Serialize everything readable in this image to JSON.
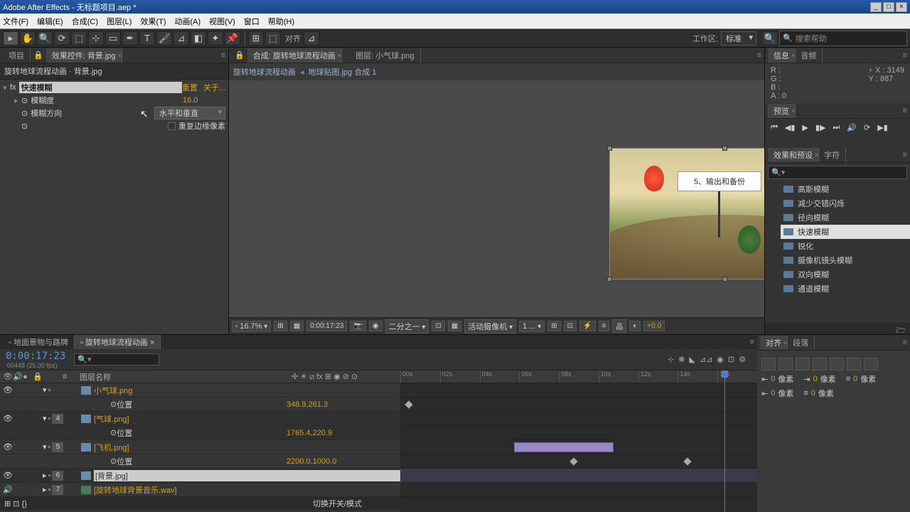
{
  "title": "Adobe After Effects - 无标题项目.aep *",
  "menu": [
    "文件(F)",
    "编辑(E)",
    "合成(C)",
    "图层(L)",
    "效果(T)",
    "动画(A)",
    "视图(V)",
    "窗口",
    "帮助(H)"
  ],
  "toolbar": {
    "snap": "对齐",
    "workspace_label": "工作区:",
    "workspace": "标准",
    "search_ph": "搜索帮助"
  },
  "left": {
    "tab_project": "项目",
    "tab_fx": "效果控件: 背景.jpg",
    "breadcrumb": "旋转地球流程动画 · 背景.jpg",
    "fx_name": "快速模糊",
    "reset": "重置",
    "about": "关于...",
    "p_blur": "模糊度",
    "v_blur": "16.0",
    "p_dir": "模糊方向",
    "v_dir": "水平和垂直",
    "p_edge": "重复边缘像素"
  },
  "comp": {
    "tab_comp": "合成: 旋转地球流程动画",
    "tab_layer": "图层: 小气球.png",
    "crumb1": "旋转地球流程动画",
    "crumb2": "地球贴图.jpg 合成 1",
    "billboard": "5、输出和备份",
    "zoom": "16.7%",
    "time": "0:00:17:23",
    "res": "二分之一",
    "cam": "活动摄像机",
    "views": "1 ...",
    "exp": "+0.0"
  },
  "info": {
    "tab1": "信息",
    "tab2": "音频",
    "r": "R :",
    "g": "G :",
    "b": "B :",
    "a": "A : 0",
    "x": "X : 3149",
    "y": "Y : 887"
  },
  "preview": {
    "tab": "预览"
  },
  "fxpanel": {
    "tab1": "效果和预设",
    "tab2": "字符",
    "items": [
      "高斯模糊",
      "减少交错闪烁",
      "径向模糊",
      "快速模糊",
      "锐化",
      "摄像机镜头模糊",
      "双向模糊",
      "通道模糊"
    ],
    "sel_idx": 3
  },
  "timeline": {
    "tab1": "地面景物与路牌",
    "tab2": "旋转地球流程动画",
    "timecode": "0:00:17:23",
    "frames": "00448 (25.00 fps)",
    "col_name": "图层名称",
    "col_switch": "切换开关/模式",
    "ruler": [
      "00s",
      "02s",
      "04s",
      "06s",
      "08s",
      "10s",
      "12s",
      "14s",
      "16s"
    ],
    "layers": [
      {
        "n": "",
        "name": "小气球.png",
        "pos": "位置",
        "val": "348.9,261.3"
      },
      {
        "n": "4",
        "name": "[气球.png]",
        "pos": "位置",
        "val": "1765.4,220.9"
      },
      {
        "n": "5",
        "name": "[飞机.png]",
        "pos": "位置",
        "val": "2200.0,1000.0"
      },
      {
        "n": "6",
        "name": "[背景.jpg]",
        "sel": true
      },
      {
        "n": "7",
        "name": "[旋转地球背景音乐.wav]",
        "audio": true
      }
    ]
  },
  "align": {
    "tab1": "对齐",
    "tab2": "段落",
    "px": "像素",
    "zero": "0"
  }
}
